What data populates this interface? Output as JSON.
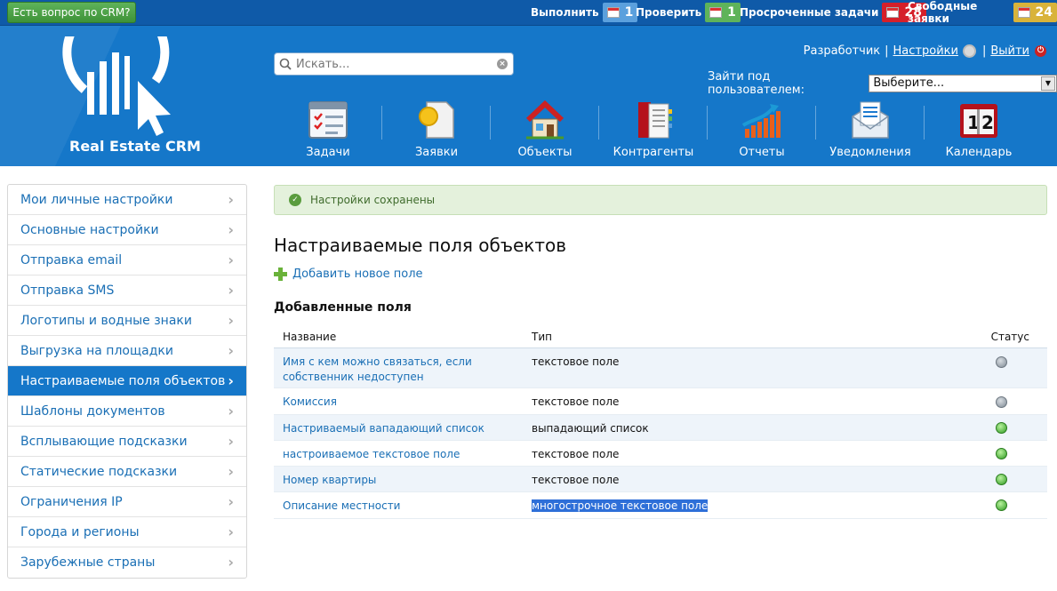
{
  "topbar": {
    "crm_question": "Есть вопрос по CRM?",
    "counters": [
      {
        "label": "Выполнить",
        "value": "1",
        "color": "#5ba0dd"
      },
      {
        "label": "Проверить",
        "value": "1",
        "color": "#5fb35a"
      },
      {
        "label": "Просроченные задачи",
        "value": "28",
        "color": "#d5202a"
      },
      {
        "label": "Свободные заявки",
        "value": "24",
        "color": "#d9b33a"
      }
    ]
  },
  "header": {
    "logo_text": "Real Estate CRM",
    "search": {
      "placeholder": "Искать..."
    },
    "user_nav": {
      "developer": "Разработчик",
      "settings": "Настройки",
      "logout": "Выйти"
    },
    "login_as": {
      "label": "Зайти под пользователем:",
      "selected": "Выберите..."
    },
    "modules": [
      {
        "label": "Задачи",
        "icon": "tasks-icon"
      },
      {
        "label": "Заявки",
        "icon": "requests-icon"
      },
      {
        "label": "Объекты",
        "icon": "house-icon"
      },
      {
        "label": "Контрагенты",
        "icon": "contacts-book-icon"
      },
      {
        "label": "Отчеты",
        "icon": "chart-icon"
      },
      {
        "label": "Уведомления",
        "icon": "envelope-icon"
      },
      {
        "label": "Календарь",
        "icon": "calendar-icon"
      }
    ]
  },
  "sidebar": {
    "items": [
      {
        "label": "Мои личные настройки"
      },
      {
        "label": "Основные настройки"
      },
      {
        "label": "Отправка email"
      },
      {
        "label": "Отправка SMS"
      },
      {
        "label": "Логотипы и водные знаки"
      },
      {
        "label": "Выгрузка на площадки"
      },
      {
        "label": "Настраиваемые поля объектов",
        "active": true
      },
      {
        "label": "Шаблоны документов"
      },
      {
        "label": "Всплывающие подсказки"
      },
      {
        "label": "Статические подсказки"
      },
      {
        "label": "Ограничения IP"
      },
      {
        "label": "Города и регионы"
      },
      {
        "label": "Зарубежные страны"
      }
    ]
  },
  "main": {
    "notice": "Настройки сохранены",
    "title": "Настраиваемые поля объектов",
    "add_link": "Добавить новое поле",
    "section_title": "Добавленные поля",
    "columns": [
      "Название",
      "Тип",
      "Статус"
    ],
    "rows": [
      {
        "name": "Имя с кем можно связаться, если собственник недоступен",
        "type": "текстовое поле",
        "status": "inactive"
      },
      {
        "name": "Комиссия",
        "type": "текстовое поле",
        "status": "inactive"
      },
      {
        "name": "Настриваемый вападающий список",
        "type": "выпадающий список",
        "status": "active"
      },
      {
        "name": "настроиваемое текстовое поле",
        "type": "текстовое поле",
        "status": "active"
      },
      {
        "name": "Номер квартиры",
        "type": "текстовое поле",
        "status": "active"
      },
      {
        "name": "Описание местности",
        "type": "многострочное текстовое поле",
        "status": "active",
        "selected": true
      }
    ]
  }
}
